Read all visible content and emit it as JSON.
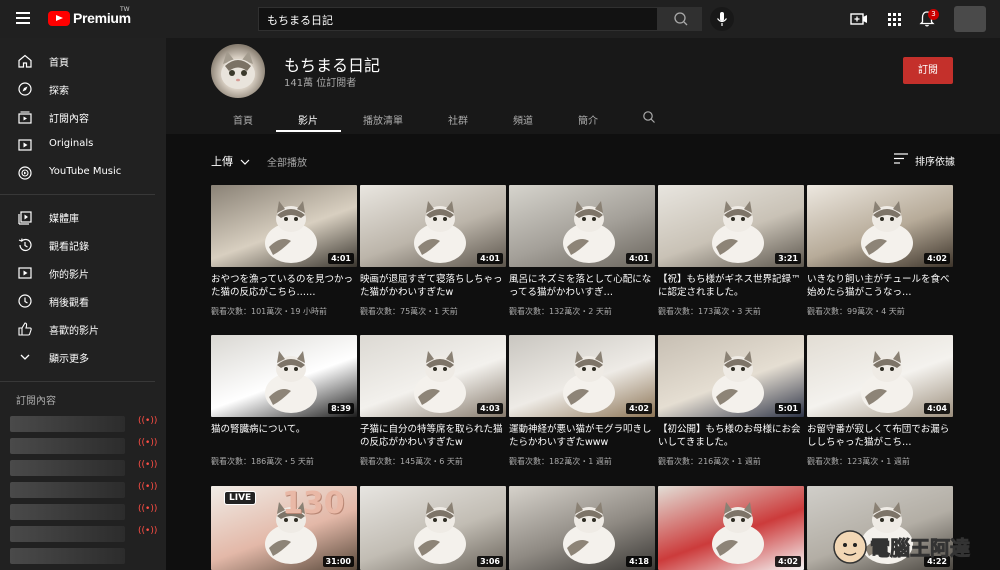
{
  "header": {
    "brand": "Premium",
    "region": "TW",
    "search_value": "もちまる日記",
    "notification_count": "3"
  },
  "sidebar": {
    "items": [
      {
        "label": "首頁",
        "icon": "home-icon"
      },
      {
        "label": "探索",
        "icon": "explore-icon"
      },
      {
        "label": "訂閱內容",
        "icon": "subscriptions-icon"
      },
      {
        "label": "Originals",
        "icon": "originals-icon"
      },
      {
        "label": "YouTube Music",
        "icon": "youtube-music-icon"
      },
      {
        "label": "媒體庫",
        "icon": "library-icon"
      },
      {
        "label": "觀看記錄",
        "icon": "history-icon"
      },
      {
        "label": "你的影片",
        "icon": "your-videos-icon"
      },
      {
        "label": "稍後觀看",
        "icon": "watch-later-icon"
      },
      {
        "label": "喜歡的影片",
        "icon": "liked-icon"
      },
      {
        "label": "顯示更多",
        "icon": "chevron-down-icon"
      }
    ],
    "subscriptions_heading": "訂閱內容"
  },
  "channel": {
    "name": "もちまる日記",
    "subscribers": "141萬 位訂閱者",
    "subscribe_label": "訂閱",
    "tabs": [
      "首頁",
      "影片",
      "播放清單",
      "社群",
      "頻道",
      "簡介"
    ],
    "active_tab": "影片"
  },
  "filters": {
    "upload_label": "上傳",
    "play_all_label": "全部播放",
    "sort_label": "排序依據"
  },
  "videos": [
    {
      "title": "おやつを漁っているのを見つかった猫の反応がこちら……",
      "meta": "觀看次數：101萬次・19 小時前",
      "duration": "4:01",
      "colors": [
        "#8a8276",
        "#d8cfc0",
        "#3a362f"
      ]
    },
    {
      "title": "映画が退屈すぎて寝落ちしちゃった猫がかわいすぎたw",
      "meta": "觀看次數：75萬次・1 天前",
      "duration": "4:01",
      "colors": [
        "#e9e6e0",
        "#bcb5aa",
        "#5c554c"
      ]
    },
    {
      "title": "風呂にネズミを落として心配になってる猫がかわいすぎ…",
      "meta": "觀看次數：132萬次・2 天前",
      "duration": "4:01",
      "colors": [
        "#d6d4cd",
        "#a4a099",
        "#6b665e"
      ]
    },
    {
      "title": "【祝】もち様がギネス世界記録™に認定されました。",
      "meta": "觀看次數：173萬次・3 天前",
      "duration": "3:21",
      "colors": [
        "#e8e5df",
        "#c9c2b6",
        "#5d574e"
      ]
    },
    {
      "title": "いきなり飼い主がチュールを食べ始めたら猫がこうなっ…",
      "meta": "觀看次數：99萬次・4 天前",
      "duration": "4:02",
      "colors": [
        "#ede8e0",
        "#b7ab99",
        "#3e352b"
      ]
    },
    {
      "title": "猫の腎臓病について。",
      "meta": "觀看次數：186萬次・5 天前",
      "duration": "8:39",
      "colors": [
        "#d9d7d2",
        "#ffffff",
        "#1c1c1c"
      ]
    },
    {
      "title": "子猫に自分の特等席を取られた猫の反応がかわいすぎたw",
      "meta": "觀看次數：145萬次・6 天前",
      "duration": "4:03",
      "colors": [
        "#dcd9d3",
        "#f3f1ed",
        "#85796b"
      ]
    },
    {
      "title": "運動神経が悪い猫がモグラ叩きしたらかわいすぎたwww",
      "meta": "觀看次數：182萬次・1 週前",
      "duration": "4:02",
      "colors": [
        "#c9c6c0",
        "#eeebe6",
        "#8c7455"
      ]
    },
    {
      "title": "【初公開】もち様のお母様にお会いしてきました。",
      "meta": "觀看次數：216萬次・1 週前",
      "duration": "5:01",
      "colors": [
        "#c7bfb3",
        "#e5ded2",
        "#2e3447"
      ]
    },
    {
      "title": "お留守番が寂しくて布団でお漏らししちゃった猫がこち…",
      "meta": "觀看次數：123萬次・1 週前",
      "duration": "4:04",
      "colors": [
        "#e2ddd4",
        "#f4f2ee",
        "#9c8f7d"
      ]
    },
    {
      "title": "",
      "meta": "",
      "duration": "31:00",
      "colors": [
        "#f0ece6",
        "#e3b8a8",
        "#5a4a3c"
      ]
    },
    {
      "title": "",
      "meta": "",
      "duration": "3:06",
      "colors": [
        "#e7e5e1",
        "#c2bdb4",
        "#6c665d"
      ]
    },
    {
      "title": "",
      "meta": "",
      "duration": "4:18",
      "colors": [
        "#d6d2cb",
        "#8f8a83",
        "#3b3936"
      ]
    },
    {
      "title": "",
      "meta": "",
      "duration": "4:02",
      "colors": [
        "#e2ded6",
        "#cc3b3b",
        "#f5f5f5"
      ]
    },
    {
      "title": "",
      "meta": "",
      "duration": "4:22",
      "colors": [
        "#d0cec9",
        "#b3aea5",
        "#4b4741"
      ]
    }
  ],
  "overlays": {
    "live_badge": "LIVE",
    "balloon_text": "130",
    "watermark": "電腦王阿達"
  }
}
